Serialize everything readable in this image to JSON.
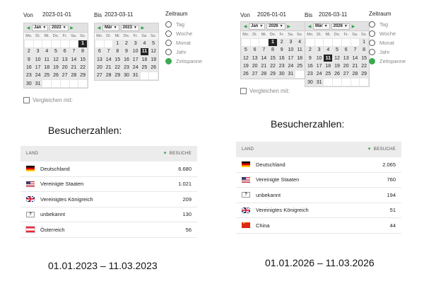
{
  "labels": {
    "von": "Von",
    "bis": "Bis",
    "zeitraum": "Zeitraum",
    "compare": "Vergleichen mit:",
    "heading": "Besucherzahlen:",
    "col_land": "LAND",
    "col_besuche": "BESUCHE"
  },
  "weekdays": [
    "Mo.",
    "Di.",
    "Mi.",
    "Do.",
    "Fr.",
    "Sa.",
    "So."
  ],
  "zeitraum_options": [
    {
      "label": "Tag",
      "selected": false
    },
    {
      "label": "Woche",
      "selected": false
    },
    {
      "label": "Monat",
      "selected": false
    },
    {
      "label": "Jahr",
      "selected": false
    },
    {
      "label": "Zeitspanne",
      "selected": true
    }
  ],
  "left": {
    "from_date": "2023-01-01",
    "to_date": "2023-03-11",
    "from_cal": {
      "month": "Jan",
      "year": "2023",
      "weeks": [
        [
          "",
          "",
          "",
          "",
          "",
          "",
          "1"
        ],
        [
          "2",
          "3",
          "4",
          "5",
          "6",
          "7",
          "8"
        ],
        [
          "9",
          "10",
          "11",
          "12",
          "13",
          "14",
          "15"
        ],
        [
          "16",
          "17",
          "18",
          "19",
          "20",
          "21",
          "22"
        ],
        [
          "23",
          "24",
          "25",
          "26",
          "27",
          "28",
          "29"
        ],
        [
          "30",
          "31",
          "",
          "",
          "",
          "",
          ""
        ]
      ],
      "selected_day": "1"
    },
    "to_cal": {
      "month": "Mär",
      "year": "2023",
      "weeks": [
        [
          "",
          "",
          "1",
          "2",
          "3",
          "4",
          "5"
        ],
        [
          "6",
          "7",
          "8",
          "9",
          "10",
          "11",
          "12"
        ],
        [
          "13",
          "14",
          "15",
          "16",
          "17",
          "18",
          "19"
        ],
        [
          "20",
          "21",
          "22",
          "23",
          "24",
          "25",
          "26"
        ],
        [
          "27",
          "28",
          "29",
          "30",
          "31",
          "",
          ""
        ]
      ],
      "selected_day": "11"
    },
    "visitors": [
      {
        "country": "Deutschland",
        "flag": "de",
        "visits": "6.680"
      },
      {
        "country": "Vereinigte Staaten",
        "flag": "us",
        "visits": "1.021"
      },
      {
        "country": "Vereinigtes Königreich",
        "flag": "uk",
        "visits": "209"
      },
      {
        "country": "unbekannt",
        "flag": "unknown",
        "visits": "130"
      },
      {
        "country": "Österreich",
        "flag": "at",
        "visits": "56"
      }
    ],
    "range_caption": "01.01.2023 – 11.03.2023"
  },
  "right": {
    "from_date": "2026-01-01",
    "to_date": "2026-03-11",
    "from_cal": {
      "month": "Jan",
      "year": "2026",
      "weeks": [
        [
          "",
          "",
          "",
          "1",
          "2",
          "3",
          "4"
        ],
        [
          "5",
          "6",
          "7",
          "8",
          "9",
          "10",
          "11"
        ],
        [
          "12",
          "13",
          "14",
          "15",
          "16",
          "17",
          "18"
        ],
        [
          "19",
          "20",
          "21",
          "22",
          "23",
          "24",
          "25"
        ],
        [
          "26",
          "27",
          "28",
          "29",
          "30",
          "31",
          ""
        ]
      ],
      "selected_day": "1"
    },
    "to_cal": {
      "month": "Mär",
      "year": "2026",
      "weeks": [
        [
          "",
          "",
          "",
          "",
          "",
          "",
          "1"
        ],
        [
          "2",
          "3",
          "4",
          "5",
          "6",
          "7",
          "8"
        ],
        [
          "9",
          "10",
          "11",
          "12",
          "13",
          "14",
          "15"
        ],
        [
          "16",
          "17",
          "18",
          "19",
          "20",
          "21",
          "22"
        ],
        [
          "23",
          "24",
          "25",
          "26",
          "27",
          "28",
          "29"
        ],
        [
          "30",
          "31",
          "",
          "",
          "",
          "",
          ""
        ]
      ],
      "selected_day": "11"
    },
    "visitors": [
      {
        "country": "Deutschland",
        "flag": "de",
        "visits": "2.065"
      },
      {
        "country": "Vereinigte Staaten",
        "flag": "us",
        "visits": "760"
      },
      {
        "country": "unbekannt",
        "flag": "unknown",
        "visits": "194"
      },
      {
        "country": "Vereinigtes Königreich",
        "flag": "uk",
        "visits": "51"
      },
      {
        "country": "China",
        "flag": "cn",
        "visits": "44"
      }
    ],
    "range_caption": "01.01.2026 – 11.03.2026"
  }
}
